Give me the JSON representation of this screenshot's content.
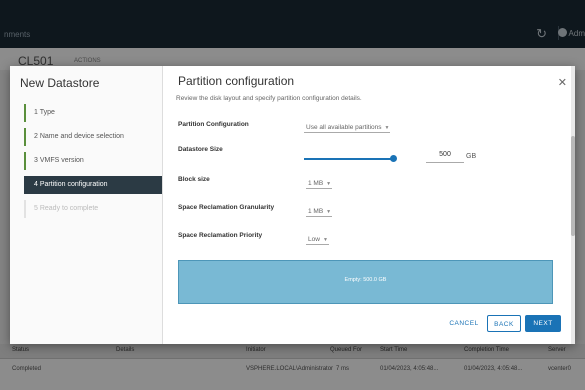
{
  "app": {
    "left_text": "nments",
    "user": "Adm",
    "host_title": "CL501",
    "host_actions": "ACTIONS"
  },
  "bg_table": {
    "headers": [
      "Status",
      "Details",
      "Initiator",
      "Queued For",
      "Start Time",
      "Completion Time",
      "Server"
    ],
    "row": [
      "Completed",
      "",
      "VSPHERE.LOCAL\\Administrator",
      "7 ms",
      "01/04/2023, 4:05:48...",
      "01/04/2023, 4:05:48...",
      "vcenter0"
    ]
  },
  "wizard": {
    "title": "New Datastore",
    "steps": [
      {
        "label": "1  Type"
      },
      {
        "label": "2  Name and device selection"
      },
      {
        "label": "3  VMFS version"
      },
      {
        "label": "4  Partition configuration"
      },
      {
        "label": "5  Ready to complete"
      }
    ],
    "active_step": 4
  },
  "content": {
    "heading": "Partition configuration",
    "subtitle": "Review the disk layout and specify partition configuration details.",
    "fields": {
      "partition_configuration": {
        "label": "Partition Configuration",
        "value": "Use all available partitions"
      },
      "datastore_size": {
        "label": "Datastore Size",
        "value": "500",
        "unit": "GB",
        "slider_fraction": 0.99
      },
      "block_size": {
        "label": "Block size",
        "value": "1 MB"
      },
      "reclamation_granularity": {
        "label": "Space Reclamation Granularity",
        "value": "1 MB"
      },
      "reclamation_priority": {
        "label": "Space Reclamation Priority",
        "value": "Low"
      }
    },
    "disk_layout_label": "Empty: 500.0 GB"
  },
  "buttons": {
    "cancel": "CANCEL",
    "back": "BACK",
    "next": "NEXT"
  },
  "icons": {
    "close": "close-icon",
    "refresh": "refresh-icon",
    "user": "user-icon"
  },
  "colors": {
    "accent": "#1a73b6",
    "active_step_bg": "#2b3a44",
    "disk_fill": "#79b9d4"
  }
}
